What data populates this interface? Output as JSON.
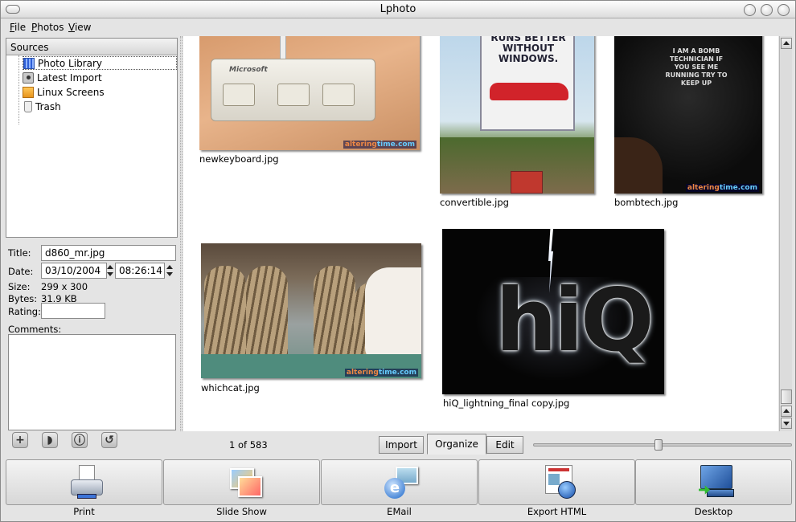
{
  "window": {
    "title": "Lphoto"
  },
  "menu": [
    "File",
    "Photos",
    "View"
  ],
  "sources": {
    "header": "Sources",
    "items": [
      {
        "label": "Photo Library",
        "icon": "photo-library-icon",
        "selected": true
      },
      {
        "label": "Latest Import",
        "icon": "camera-icon"
      },
      {
        "label": "Linux Screens",
        "icon": "folder-icon"
      },
      {
        "label": "Trash",
        "icon": "trash-icon"
      }
    ]
  },
  "info": {
    "title_label": "Title:",
    "title_value": "d860_mr.jpg",
    "date_label": "Date:",
    "date_value": "03/10/2004",
    "time_value": "08:26:14",
    "size_label": "Size:",
    "size_value": "299 x 300",
    "bytes_label": "Bytes:",
    "bytes_value": "31.9 KB",
    "rating_label": "Rating:",
    "rating_value": "",
    "comments_label": "Comments:",
    "comments_value": ""
  },
  "tools": [
    "add-icon",
    "rotate-icon",
    "info-icon",
    "rotate-left-icon"
  ],
  "photos": [
    {
      "filename": "newkeyboard.jpg",
      "watermark": "altering",
      "watermark_b": "time.com"
    },
    {
      "filename": "convertible.jpg",
      "billboard": "RUNS BETTER WITHOUT WINDOWS."
    },
    {
      "filename": "bombtech.jpg",
      "shirt": "I AM A BOMB TECHNICIAN IF YOU SEE ME RUNNING TRY TO KEEP UP",
      "watermark": "altering",
      "watermark_b": "time.com"
    },
    {
      "filename": "whichcat.jpg",
      "watermark": "altering",
      "watermark_b": "time.com"
    },
    {
      "filename": "hiQ_lightning_final copy.jpg",
      "word": "hiQ"
    }
  ],
  "status": {
    "count": "1 of 583"
  },
  "tabs": [
    {
      "label": "Import"
    },
    {
      "label": "Organize",
      "active": true
    },
    {
      "label": "Edit"
    }
  ],
  "zoom_slider_fraction": 0.48,
  "toolbar": [
    {
      "label": "Print",
      "icon": "printer-icon"
    },
    {
      "label": "Slide Show",
      "icon": "slideshow-icon"
    },
    {
      "label": "EMail",
      "icon": "email-icon"
    },
    {
      "label": "Export HTML",
      "icon": "export-html-icon"
    },
    {
      "label": "Desktop",
      "icon": "desktop-icon"
    }
  ]
}
